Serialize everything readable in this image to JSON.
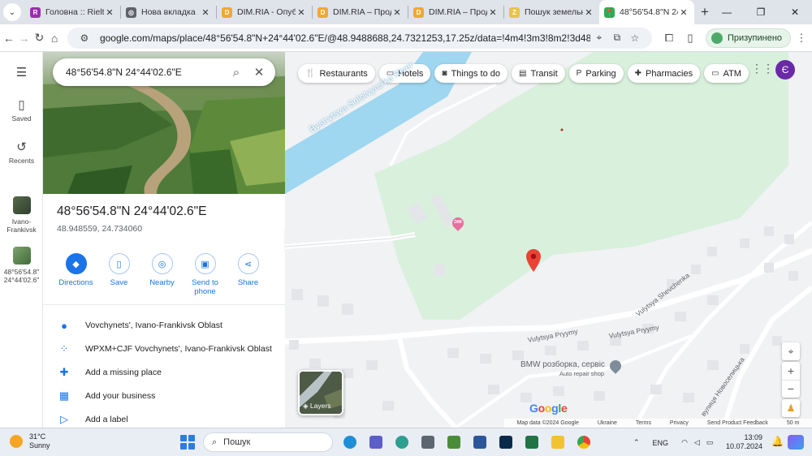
{
  "browser": {
    "tabs": [
      {
        "title": "Головна :: Rielto",
        "icon_color": "#9b2fae",
        "icon_glyph": "R",
        "active": false
      },
      {
        "title": "Нова вкладка",
        "icon_color": "#5f6368",
        "icon_glyph": "◎",
        "active": false
      },
      {
        "title": "DIM.RIA - Опубл",
        "icon_color": "#f0a830",
        "icon_glyph": "D",
        "active": false
      },
      {
        "title": "DIM.RIA – Прод",
        "icon_color": "#f0a830",
        "icon_glyph": "D",
        "active": false
      },
      {
        "title": "DIM.RIA – Прод",
        "icon_color": "#f0a830",
        "icon_glyph": "D",
        "active": false
      },
      {
        "title": "Пошук земельн",
        "icon_color": "#e8c34a",
        "icon_glyph": "Z",
        "active": false
      },
      {
        "title": "48°56'54.8\"N 24",
        "icon_color": "#34a853",
        "icon_glyph": "📍",
        "active": true
      }
    ],
    "url": "google.com/maps/place/48°56'54.8\"N+24°44'02.6\"E/@48.9488688,24.7321253,17.25z/data=!4m4!3m3!8m2!3d48.9485594!4d24.7340...",
    "profile_label": "Призупинено"
  },
  "rail": {
    "saved": "Saved",
    "recents": "Recents",
    "recent_places": [
      {
        "label": "Ivano-\nFrankivsk"
      },
      {
        "label": "48°56'54.8\"\n24°44'02.6\""
      }
    ]
  },
  "panel": {
    "search_value": "48°56'54.8\"N 24°44'02.6\"E",
    "title": "48°56'54.8\"N 24°44'02.6\"E",
    "subtitle": "48.948559, 24.734060",
    "actions": [
      {
        "label": "Directions",
        "icon": "directions-icon",
        "glyph": "◆"
      },
      {
        "label": "Save",
        "icon": "bookmark-icon",
        "glyph": "▯"
      },
      {
        "label": "Nearby",
        "icon": "nearby-icon",
        "glyph": "◎"
      },
      {
        "label": "Send to phone",
        "icon": "phone-icon",
        "glyph": "▣"
      },
      {
        "label": "Share",
        "icon": "share-icon",
        "glyph": "⋖"
      }
    ],
    "info_rows": [
      {
        "text": "Vovchynets', Ivano-Frankivsk Oblast",
        "icon": "location-pin-icon",
        "glyph": "●"
      },
      {
        "text": "WPXM+CJF Vovchynets', Ivano-Frankivsk Oblast",
        "icon": "plus-code-icon",
        "glyph": "⁘"
      },
      {
        "text": "Add a missing place",
        "icon": "add-place-icon",
        "glyph": "✚"
      },
      {
        "text": "Add your business",
        "icon": "add-business-icon",
        "glyph": "▦"
      },
      {
        "text": "Add a label",
        "icon": "label-icon",
        "glyph": "▷"
      }
    ]
  },
  "map": {
    "chips": [
      {
        "label": "Restaurants",
        "glyph": "🍴"
      },
      {
        "label": "Hotels",
        "glyph": "▭"
      },
      {
        "label": "Things to do",
        "glyph": "◙"
      },
      {
        "label": "Transit",
        "glyph": "▤"
      },
      {
        "label": "Parking",
        "glyph": "P"
      },
      {
        "label": "Pharmacies",
        "glyph": "✚"
      },
      {
        "label": "ATM",
        "glyph": "▭"
      }
    ],
    "account_initial": "Є",
    "river_label": "Bystrytsya-Solotvyns'ka River",
    "streets": [
      "Vulytsya Shevchenka",
      "Vulytsya Pryymy",
      "Vulytsya Pryymy",
      "вулиця Новоселицька"
    ],
    "poi_icon_text": "DIM",
    "business_name": "BMW розборка, сервіс",
    "business_type": "Auto repair shop",
    "layers_label": "Layers",
    "google_logo": "Google",
    "attribution": [
      "Map data ©2024 Google",
      "Ukraine",
      "Terms",
      "Privacy",
      "Send Product Feedback",
      "50 m"
    ],
    "colors": {
      "park": "#d8f0dc",
      "river": "#9fd6f0",
      "pin": "#ea4335"
    }
  },
  "taskbar": {
    "temperature": "31°C",
    "weather_text": "Sunny",
    "search_placeholder": "Пошук",
    "language": "ENG",
    "time": "13:09",
    "date": "10.07.2024"
  }
}
